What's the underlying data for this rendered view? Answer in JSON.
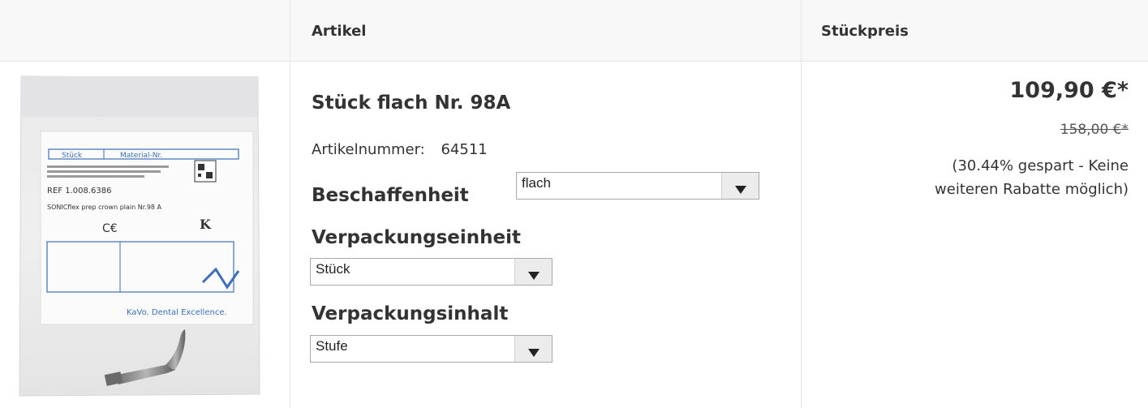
{
  "table": {
    "headers": {
      "article": "Artikel",
      "unit_price": "Stückpreis"
    }
  },
  "product": {
    "image_alt": "KaVo SONICflex prep crown plain Nr.98 A package",
    "image_text": {
      "col1": "Stück",
      "col2": "Material-Nr.",
      "ref": "REF 1.008.6386",
      "name": "SONICflex prep crown plain Nr.98 A",
      "brand": "KaVo. Dental Excellence."
    },
    "title": "Stück flach Nr. 98A",
    "article_number_label": "Artikelnummer:",
    "article_number": "64511"
  },
  "options": {
    "beschaffenheit": {
      "label": "Beschaffenheit",
      "value": "flach"
    },
    "verpackungseinheit": {
      "label": "Verpackungseinheit",
      "value": "Stück"
    },
    "verpackungsinhalt": {
      "label": "Verpackungsinhalt",
      "value": "Stufe"
    }
  },
  "pricing": {
    "price": "109,90 €*",
    "old_price": "158,00 €*",
    "saving_line1": "(30.44% gespart - Keine",
    "saving_line2": "weiteren Rabatte möglich)"
  },
  "colors": {
    "header_bg": "#f8f8f8",
    "border": "#e6e6e6",
    "text": "#333333"
  }
}
